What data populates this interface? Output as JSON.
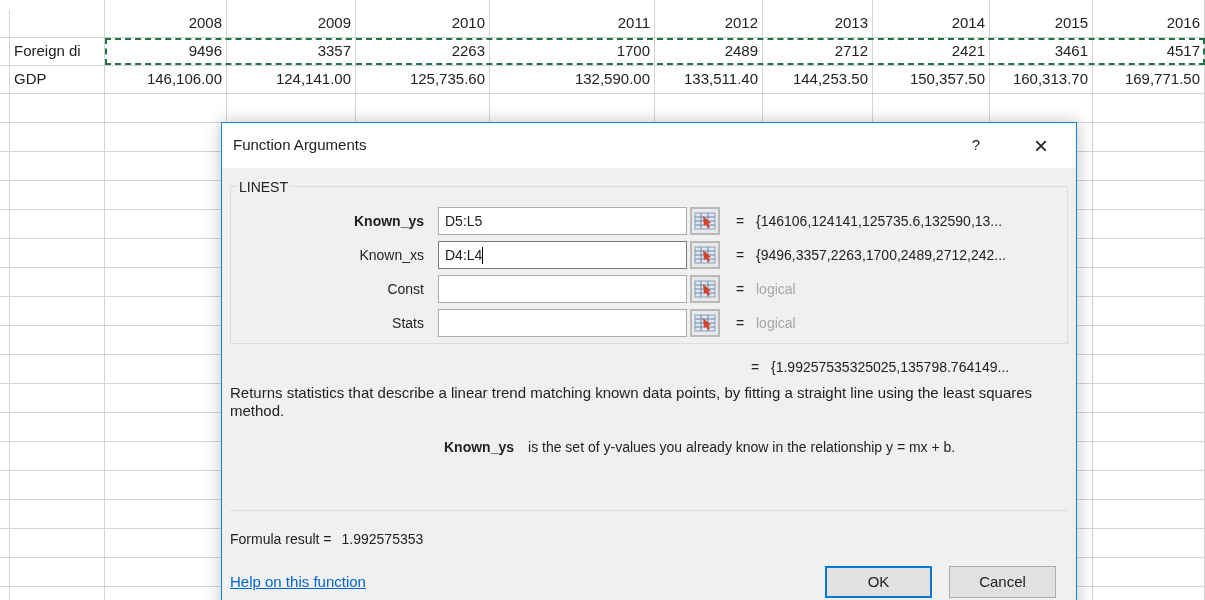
{
  "sheet": {
    "rows": [
      {
        "label": "",
        "copied": false,
        "cells": [
          "2008",
          "2009",
          "2010",
          "2011",
          "2012",
          "2013",
          "2014",
          "2015",
          "2016"
        ]
      },
      {
        "label": "Foreign di",
        "copied": true,
        "cells": [
          "9496",
          "3357",
          "2263",
          "1700",
          "2489",
          "2712",
          "2421",
          "3461",
          "4517"
        ]
      },
      {
        "label": "GDP",
        "copied": false,
        "cells": [
          "146,106.00",
          "124,141.00",
          "125,735.60",
          "132,590.00",
          "133,511.40",
          "144,253.50",
          "150,357.50",
          "160,313.70",
          "169,771.50"
        ]
      }
    ]
  },
  "dialog": {
    "title": "Function Arguments",
    "help": "?",
    "close": "×",
    "group": "LINEST",
    "arguments": [
      {
        "label": "Known_ys",
        "bold": true,
        "value": "D5:L5",
        "focused": false,
        "eq": "=",
        "result": "{146106,124141,125735.6,132590,13...",
        "dimmed": false
      },
      {
        "label": "Known_xs",
        "bold": false,
        "value": "D4:L4",
        "focused": true,
        "eq": "=",
        "result": "{9496,3357,2263,1700,2489,2712,242...",
        "dimmed": false
      },
      {
        "label": "Const",
        "bold": false,
        "focused": false,
        "eq": "=",
        "result": "logical",
        "dimmed": true
      },
      {
        "label": "Stats",
        "bold": false,
        "focused": false,
        "eq": "=",
        "result": "logical",
        "dimmed": true
      }
    ],
    "total_eq": "=",
    "total": "{1.99257535325025,135798.764149...",
    "description": "Returns statistics that describe a linear trend matching known data points, by fitting a straight line using the least squares method.",
    "arg_help_label": "Known_ys",
    "arg_help_text": "is the set of y-values you already know in the relationship y = mx + b.",
    "formula_label": "Formula result =",
    "formula_value": "1.992575353",
    "help_link": "Help on this function",
    "buttons": [
      {
        "label": "OK",
        "default": true
      },
      {
        "label": "Cancel",
        "default": false
      }
    ]
  }
}
